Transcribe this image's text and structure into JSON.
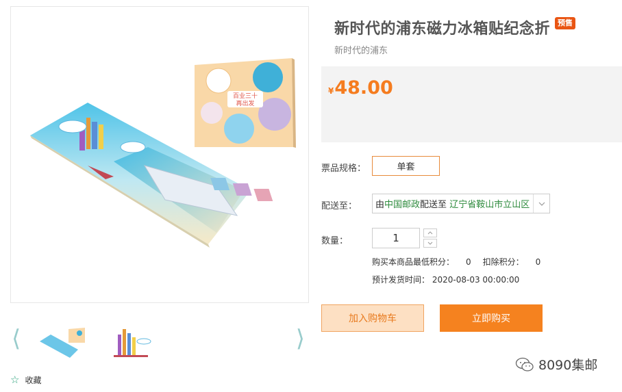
{
  "product": {
    "title": "新时代的浦东磁力冰箱贴纪念折",
    "badge": "预售",
    "subtitle": "新时代的浦东",
    "price_currency": "¥",
    "price_value": "48.00"
  },
  "spec": {
    "label": "票品规格：",
    "option": "单套"
  },
  "shipping": {
    "label": "配送至：",
    "prefix": "由",
    "carrier": "中国邮政",
    "middle": "配送至",
    "destination": "辽宁省鞍山市立山区"
  },
  "quantity": {
    "label": "数量：",
    "value": "1"
  },
  "points": {
    "min_label": "购买本商品最低积分：",
    "min_value": "0",
    "deduct_label": "扣除积分：",
    "deduct_value": "0"
  },
  "ship_time": {
    "label": "预计发货时间：",
    "value": "2020-08-03 00:00:00"
  },
  "actions": {
    "add_to_cart": "加入购物车",
    "buy_now": "立即购买"
  },
  "favorite": {
    "label": "收藏"
  },
  "gallery": {
    "prev_arrow": "⟨",
    "next_arrow": "⟩",
    "card_text_line1": "百业三十",
    "card_text_line2": "再出发"
  },
  "watermark": {
    "text": "8090集邮"
  },
  "colors": {
    "accent_orange": "#f5821f",
    "badge_red": "#e95513",
    "green": "#2e8b3d"
  }
}
